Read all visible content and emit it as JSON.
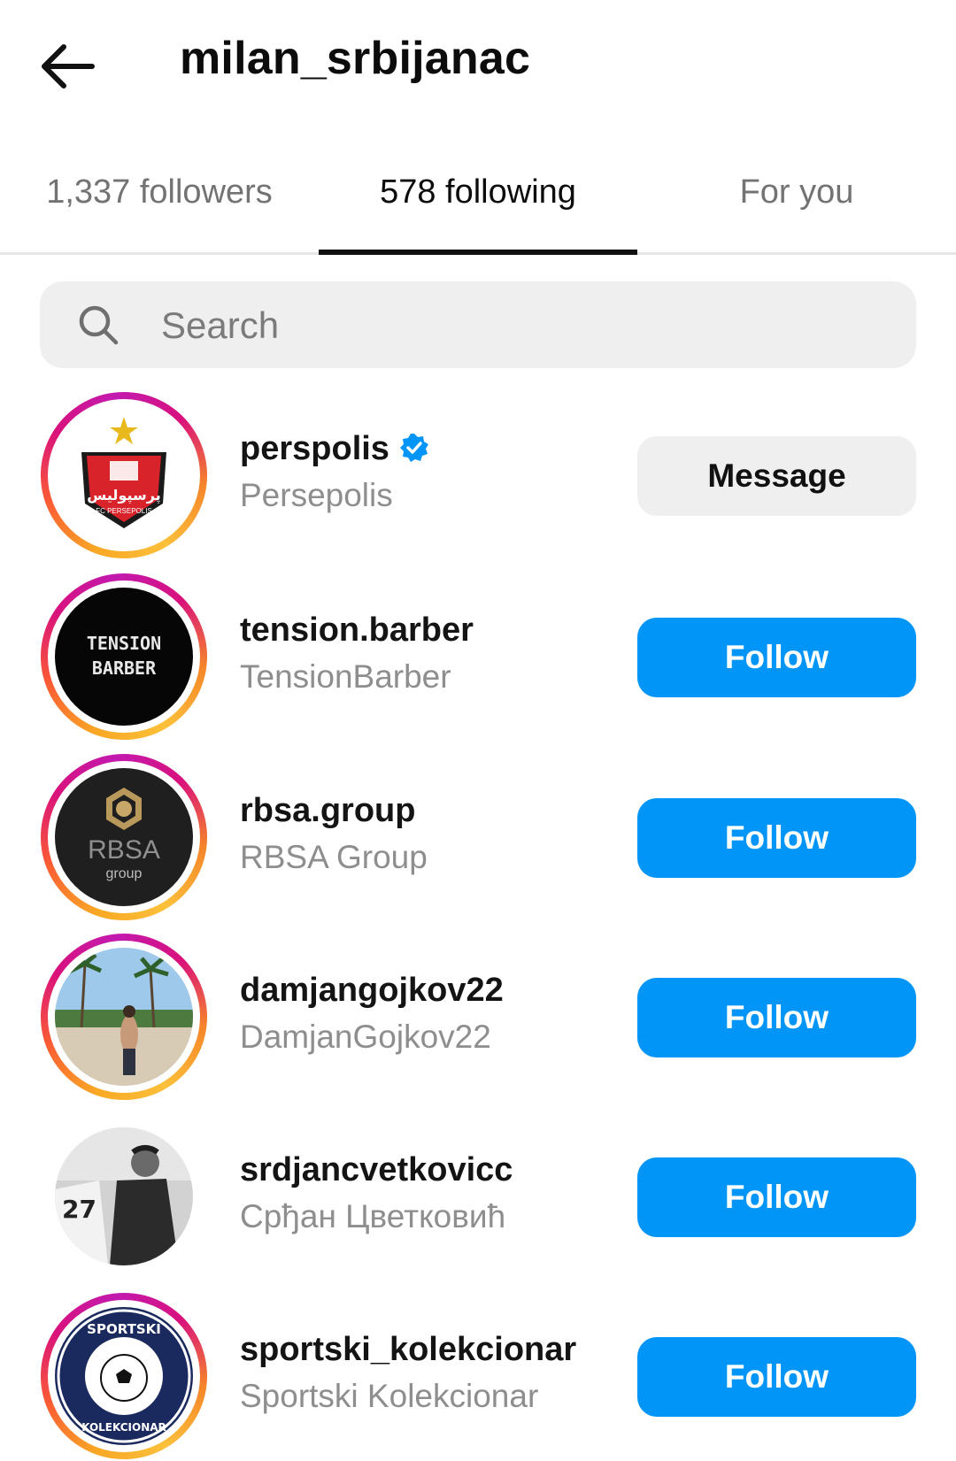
{
  "header": {
    "back_icon": "arrow-left-icon",
    "title": "milan_srbijanac"
  },
  "tabs": [
    {
      "label": "1,337 followers",
      "active": false
    },
    {
      "label": "578 following",
      "active": true
    },
    {
      "label": "For you",
      "active": false
    }
  ],
  "search": {
    "icon": "search-icon",
    "placeholder": "Search",
    "value": ""
  },
  "accounts": [
    {
      "username": "perspolis",
      "verified": true,
      "full_name": "Persepolis",
      "story_ring": true,
      "button": "Message",
      "logo_text": "پرسپولیس",
      "logo_subtext": "FC PERSEPOLIS"
    },
    {
      "username": "tension.barber",
      "verified": false,
      "full_name": "TensionBarber",
      "story_ring": true,
      "button": "Follow",
      "logo_text": "TENSION",
      "logo_subtext": "BARBER"
    },
    {
      "username": "rbsa.group",
      "verified": false,
      "full_name": "RBSA Group",
      "story_ring": true,
      "button": "Follow",
      "logo_text": "RBSA",
      "logo_subtext": "group"
    },
    {
      "username": "damjangojkov22",
      "verified": false,
      "full_name": "DamjanGojkov22",
      "story_ring": true,
      "button": "Follow"
    },
    {
      "username": "srdjancvetkovicc",
      "verified": false,
      "full_name": "Срђан Цветковић",
      "story_ring": false,
      "button": "Follow"
    },
    {
      "username": "sportski_kolekcionar",
      "verified": false,
      "full_name": "Sportski Kolekcionar",
      "story_ring": true,
      "button": "Follow",
      "logo_text": "SPORTSKI",
      "logo_subtext": "KOLEKCIONAR"
    }
  ],
  "colors": {
    "follow_button": "#0095f6",
    "message_button": "#efefef",
    "verified_badge": "#0095f6",
    "secondary_text": "#8e8e8e"
  }
}
